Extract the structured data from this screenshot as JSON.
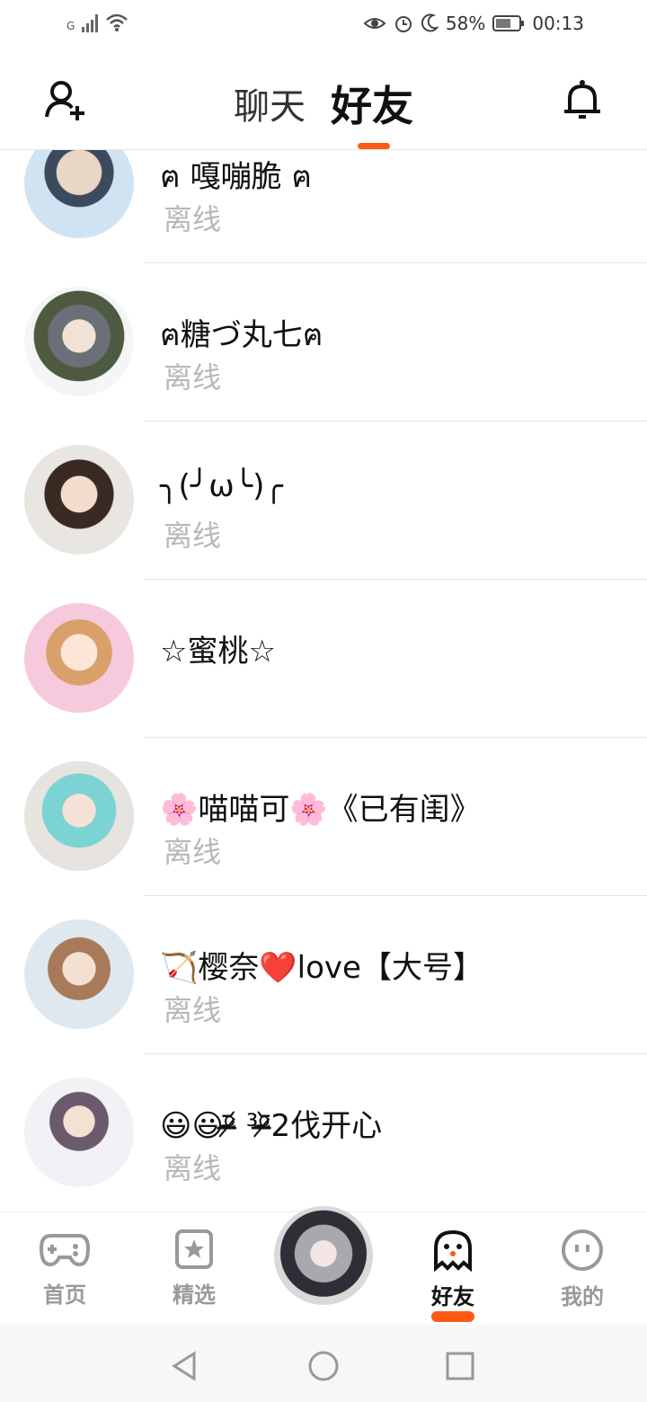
{
  "statusbar": {
    "network": "G",
    "battery": "58%",
    "time": "00:13",
    "icons": [
      "signal-icon",
      "wifi-icon",
      "eye-comfort-icon",
      "alarm-icon",
      "moon-icon",
      "battery-icon"
    ]
  },
  "header": {
    "tab_chat": "聊天",
    "tab_friends": "好友",
    "add_friend_icon": "add-person-icon",
    "notification_icon": "bell-icon",
    "accent": "#ff5a14"
  },
  "friends": [
    {
      "name": "ฅ 嘎嘣脆 ฅ",
      "status": "离线"
    },
    {
      "name": "ฅ糖づ丸七ฅ",
      "status": "离线"
    },
    {
      "name": "╮(╯ω╰)╭",
      "status": "离线"
    },
    {
      "name": "☆蜜桃☆",
      "status": ""
    },
    {
      "name": "🌸喵喵可🌸《已有闺》",
      "status": "离线"
    },
    {
      "name": "🏹樱奈❤️love【大号】",
      "status": "离线"
    },
    {
      "name": "😃😃ᵒ̴̶̷᷄ ³ᵒ̴̶̷᷅2伐开心",
      "status": "离线"
    }
  ],
  "bottom_nav": {
    "home": "首页",
    "featured": "精选",
    "friends": "好友",
    "mine": "我的"
  },
  "colors": {
    "accent": "#ff5a14",
    "muted_text": "#b8b8b8",
    "inactive_nav": "#999999"
  }
}
